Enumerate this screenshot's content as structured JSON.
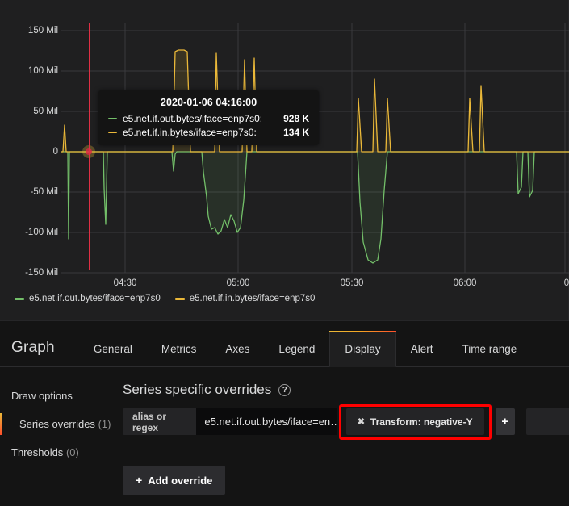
{
  "graph": {
    "y_axis": {
      "ticks": [
        "150 Mil",
        "100 Mil",
        "50 Mil",
        "0",
        "-50 Mil",
        "-100 Mil",
        "-150 Mil"
      ]
    },
    "x_axis": {
      "ticks": [
        "04:30",
        "05:00",
        "05:30",
        "06:00",
        "0"
      ]
    },
    "crosshair_time": "2020-01-06 04:16:00",
    "tooltip": {
      "time": "2020-01-06 04:16:00",
      "rows": [
        {
          "name": "e5.net.if.out.bytes/iface=enp7s0:",
          "value": "928 K",
          "color": "#73BF69"
        },
        {
          "name": "e5.net.if.in.bytes/iface=enp7s0:",
          "value": "134 K",
          "color": "#EAB839"
        }
      ]
    },
    "legend": [
      {
        "label": "e5.net.if.out.bytes/iface=enp7s0",
        "color": "#73BF69"
      },
      {
        "label": "e5.net.if.in.bytes/iface=enp7s0",
        "color": "#EAB839"
      }
    ]
  },
  "chart_data": {
    "type": "line",
    "title": "",
    "xlabel": "",
    "ylabel": "",
    "ylim": [
      -150000000,
      150000000
    ],
    "ytick_labels": [
      "150 Mil",
      "100 Mil",
      "50 Mil",
      "0",
      "-50 Mil",
      "-100 Mil",
      "-150 Mil"
    ],
    "ytick_values": [
      150000000,
      100000000,
      50000000,
      0,
      -50000000,
      -100000000,
      -150000000
    ],
    "xtick_labels": [
      "04:30",
      "05:00",
      "05:30",
      "06:00"
    ],
    "grid": true,
    "legend_position": "bottom-left",
    "fill": true,
    "series": [
      {
        "name": "e5.net.if.out.bytes/iface=enp7s0",
        "color": "#73BF69",
        "note": "rendered negative-Y via series override",
        "x": [
          0,
          2,
          3,
          4,
          5,
          6,
          7,
          8,
          9,
          10,
          12,
          14,
          16,
          18,
          20,
          21,
          22,
          23,
          24,
          25,
          26,
          27,
          28,
          29,
          30,
          31,
          32,
          33,
          34,
          35,
          36,
          37,
          38,
          39,
          40,
          41,
          42,
          43,
          44,
          45,
          46,
          47,
          48,
          49,
          50,
          51,
          52,
          53,
          54,
          55,
          56,
          57,
          58,
          60,
          62,
          64,
          66,
          68,
          70,
          72,
          74,
          76,
          78,
          80,
          82,
          84,
          86,
          88,
          90,
          92,
          94,
          96,
          98,
          100
        ],
        "y": [
          0,
          0,
          -108,
          -1,
          -1,
          -1,
          -1,
          -1,
          -1,
          -1,
          -1,
          -1,
          -1,
          -1,
          -1,
          -1,
          -46,
          -90,
          -1,
          -1,
          -1,
          -1,
          -1,
          -1,
          -1,
          -24,
          -3,
          -1,
          -1,
          -1,
          -1,
          -1,
          -50,
          -105,
          -120,
          -118,
          -122,
          -117,
          -95,
          -108,
          -88,
          -101,
          -120,
          -108,
          -60,
          -1,
          -1,
          -1,
          -1,
          -1,
          -1,
          -1,
          -1,
          -1,
          -128,
          -138,
          -110,
          -1,
          -1,
          -1,
          -1,
          -1,
          -1,
          -1,
          -1,
          -1,
          -1,
          -1,
          -1,
          -1,
          -50,
          -58,
          -52,
          -1
        ]
      },
      {
        "name": "e5.net.if.in.bytes/iface=enp7s0",
        "color": "#EAB839",
        "x": [
          0,
          2,
          3,
          4,
          5,
          6,
          7,
          8,
          9,
          10,
          12,
          14,
          16,
          18,
          20,
          21,
          22,
          23,
          24,
          25,
          26,
          27,
          28,
          29,
          30,
          31,
          32,
          33,
          34,
          35,
          36,
          37,
          38,
          39,
          40,
          41,
          42,
          43,
          44,
          45,
          46,
          47,
          48,
          49,
          50,
          51,
          52,
          53,
          54,
          55,
          56,
          57,
          58,
          60,
          62,
          64,
          66,
          68,
          70,
          72,
          74,
          76,
          78,
          80,
          82,
          84,
          86,
          88,
          90,
          92,
          94,
          96,
          98,
          100
        ],
        "y": [
          0,
          32,
          1,
          1,
          1,
          1,
          1,
          1,
          1,
          1,
          1,
          1,
          1,
          1,
          1,
          1,
          1,
          1,
          1,
          1,
          1,
          122,
          124,
          124,
          1,
          1,
          1,
          118,
          1,
          1,
          1,
          106,
          108,
          1,
          1,
          1,
          1,
          1,
          1,
          1,
          1,
          1,
          1,
          1,
          1,
          1,
          1,
          1,
          1,
          1,
          85,
          1,
          1,
          1,
          1,
          1,
          1,
          1,
          118,
          1,
          72,
          1,
          1,
          1,
          1,
          1,
          1,
          72,
          92,
          1,
          1,
          1,
          1,
          1
        ]
      }
    ]
  },
  "editor": {
    "panel_title": "Graph",
    "tabs": [
      {
        "label": "General",
        "active": false
      },
      {
        "label": "Metrics",
        "active": false
      },
      {
        "label": "Axes",
        "active": false
      },
      {
        "label": "Legend",
        "active": false
      },
      {
        "label": "Display",
        "active": true
      },
      {
        "label": "Alert",
        "active": false
      },
      {
        "label": "Time range",
        "active": false
      }
    ],
    "sidebar": [
      {
        "label": "Draw options",
        "count": "",
        "active": false
      },
      {
        "label": "Series overrides",
        "count": "(1)",
        "active": true
      },
      {
        "label": "Thresholds",
        "count": "(0)",
        "active": false
      }
    ],
    "overrides_heading": "Series specific overrides",
    "help_icon_glyph": "?",
    "override_row": {
      "alias_label": "alias or regex",
      "alias_value": "e5.net.if.out.bytes/iface=en…",
      "alias_placeholder": "alias or regex",
      "chip_close_glyph": "✖",
      "chip_label": "Transform: negative-Y",
      "add_prop_glyph": "+"
    },
    "add_override_label": "Add override",
    "add_override_glyph": "+"
  },
  "colors": {
    "series_out": "#73BF69",
    "series_in": "#EAB839",
    "crosshair": "#e02f44",
    "highlight": "#ff0000",
    "panel_bg": "#1f1f20",
    "page_bg": "#141414"
  }
}
